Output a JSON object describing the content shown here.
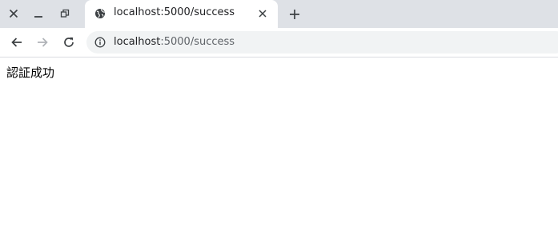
{
  "browser": {
    "tab": {
      "title": "localhost:5000/success",
      "favicon": "globe-icon"
    },
    "window_controls": [
      "close-icon",
      "minimize-icon",
      "restore-icon"
    ],
    "new_tab_icon": "plus-icon",
    "nav": {
      "back_icon": "arrow-left-icon",
      "forward_icon": "arrow-right-icon",
      "reload_icon": "reload-icon"
    },
    "address": {
      "info_icon": "info-icon",
      "host": "localhost",
      "rest": ":5000/success"
    },
    "colors": {
      "tabstrip": "#dee1e6",
      "active_tab": "#ffffff",
      "omnibox": "#f1f3f4"
    }
  },
  "page": {
    "message": "認証成功"
  }
}
